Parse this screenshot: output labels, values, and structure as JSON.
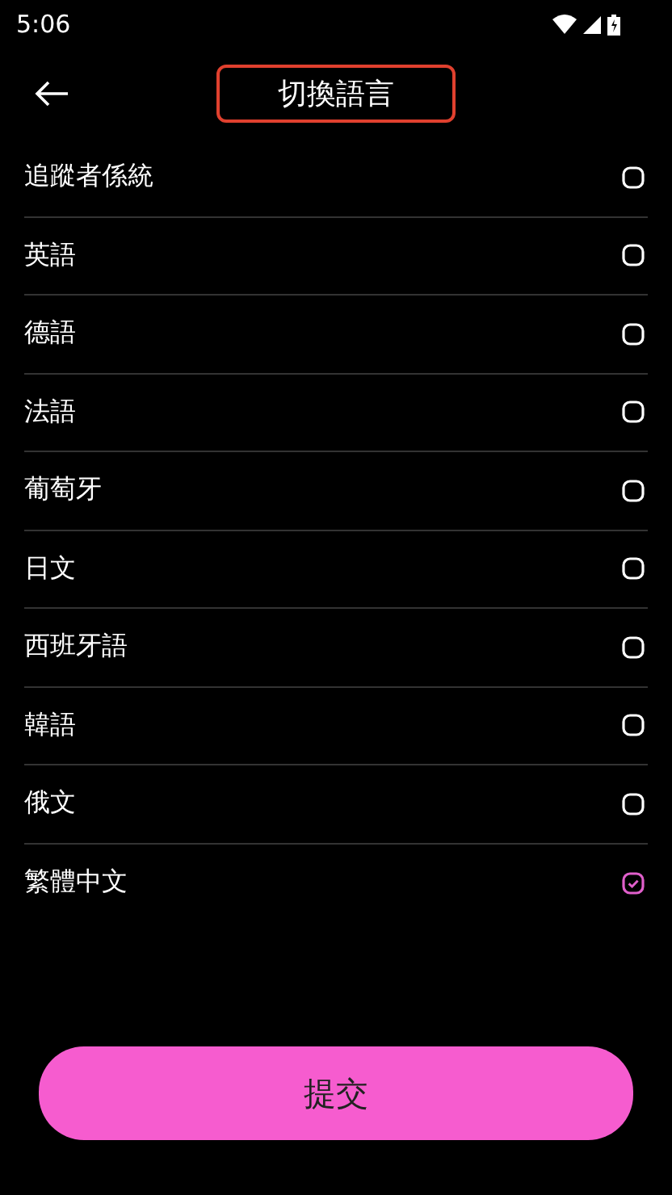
{
  "status_bar": {
    "time": "5:06"
  },
  "header": {
    "title": "切換語言",
    "highlighted": true
  },
  "languages": [
    {
      "label": "追蹤者係統",
      "selected": false
    },
    {
      "label": "英語",
      "selected": false
    },
    {
      "label": "德語",
      "selected": false
    },
    {
      "label": "法語",
      "selected": false
    },
    {
      "label": "葡萄牙",
      "selected": false
    },
    {
      "label": "日文",
      "selected": false
    },
    {
      "label": "西班牙語",
      "selected": false
    },
    {
      "label": "韓語",
      "selected": false
    },
    {
      "label": "俄文",
      "selected": false
    },
    {
      "label": "繁體中文",
      "selected": true
    }
  ],
  "submit_button": {
    "label": "提交"
  }
}
